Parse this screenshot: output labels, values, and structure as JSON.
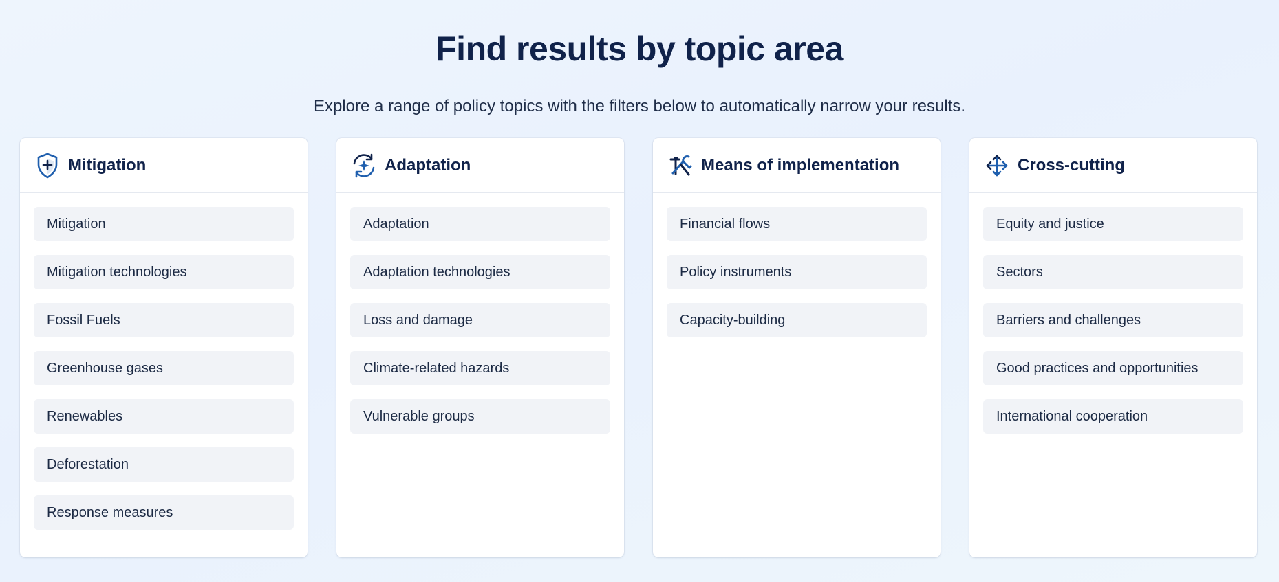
{
  "header": {
    "title": "Find results by topic area",
    "subtitle": "Explore a range of policy topics with the filters below to automatically narrow your results."
  },
  "colors": {
    "accent": "#1f5fae",
    "title": "#10224a",
    "item_bg": "#f1f3f7"
  },
  "cards": [
    {
      "title": "Mitigation",
      "icon": "shield-plus-icon",
      "items": [
        "Mitigation",
        "Mitigation technologies",
        "Fossil Fuels",
        "Greenhouse gases",
        "Renewables",
        "Deforestation",
        "Response measures"
      ]
    },
    {
      "title": "Adaptation",
      "icon": "cycle-sparkle-icon",
      "items": [
        "Adaptation",
        "Adaptation technologies",
        "Loss and damage",
        "Climate-related hazards",
        "Vulnerable groups"
      ]
    },
    {
      "title": "Means of implementation",
      "icon": "tools-icon",
      "items": [
        "Financial flows",
        "Policy instruments",
        "Capacity-building"
      ]
    },
    {
      "title": "Cross-cutting",
      "icon": "arrows-expand-icon",
      "items": [
        "Equity and justice",
        "Sectors",
        "Barriers and challenges",
        "Good practices and opportunities",
        "International cooperation"
      ]
    }
  ]
}
